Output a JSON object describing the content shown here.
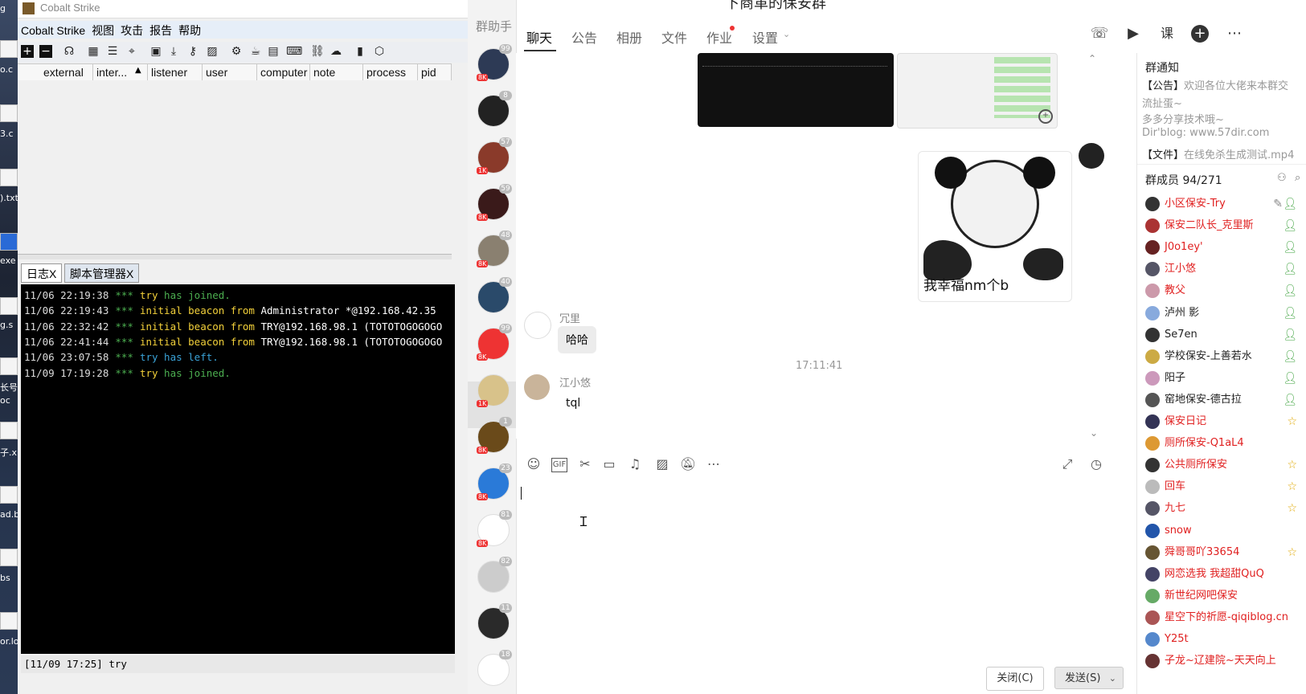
{
  "desktop": {
    "labels": [
      "g",
      "o.c",
      "3.c",
      ").txt",
      "exe",
      "g.s",
      "长号种",
      "oc",
      "子.xl",
      "ad.b",
      "bs",
      "or.lo"
    ]
  },
  "cs": {
    "title": "Cobalt Strike",
    "menu": [
      "Cobalt Strike",
      "视图",
      "攻击",
      "报告",
      "帮助"
    ],
    "columns": [
      "external",
      "inter...",
      "listener",
      "user",
      "computer",
      "note",
      "process",
      "pid"
    ],
    "tabs": [
      "日志X",
      "脚本管理器X"
    ],
    "log": [
      {
        "time": "11/06 22:19:38",
        "stars": "***",
        "pre": "",
        "who": "try",
        "rest": " has joined.",
        "kind": "join"
      },
      {
        "time": "11/06 22:19:43",
        "stars": "***",
        "pre": "initial beacon from ",
        "who": "Administrator *@192.168.42.35",
        "rest": "",
        "kind": "beacon"
      },
      {
        "time": "11/06 22:32:42",
        "stars": "***",
        "pre": "initial beacon from ",
        "who": "TRY@192.168.98.1 (TOTOTOGOGOGO",
        "rest": "",
        "kind": "beacon"
      },
      {
        "time": "11/06 22:41:44",
        "stars": "***",
        "pre": "initial beacon from ",
        "who": "TRY@192.168.98.1 (TOTOTOGOGOGO",
        "rest": "",
        "kind": "beacon"
      },
      {
        "time": "11/06 23:07:58",
        "stars": "***",
        "pre": "",
        "who": "try",
        "rest": " has left.",
        "kind": "left"
      },
      {
        "time": "11/09 17:19:28",
        "stars": "***",
        "pre": "",
        "who": "try",
        "rest": " has joined.",
        "kind": "join"
      }
    ],
    "status": "[11/09 17:25] try"
  },
  "qq": {
    "title": "下商革的保安群",
    "sidebar_header": "群助手",
    "group_badges": [
      "99",
      "8",
      "57",
      "59",
      "48",
      "40",
      "99",
      "",
      "1",
      "23",
      "81",
      "82",
      "11",
      "18"
    ],
    "group_levels": [
      "8K",
      "",
      "1K",
      "8K",
      "8K",
      "",
      "8K",
      "1K",
      "8K",
      "8K",
      "8K",
      "",
      "",
      ""
    ],
    "tabs": [
      "聊天",
      "公告",
      "相册",
      "文件",
      "作业",
      "设置"
    ],
    "chat": {
      "sticker_caption": "我幸福nm个b",
      "msg1_nick": "冗里",
      "msg1_text": "哈哈",
      "timestamp": "17:11:41",
      "msg2_nick": "江小悠",
      "msg2_text": "tql"
    },
    "buttons": {
      "close": "关闭(C)",
      "send": "发送(S)"
    },
    "notice": {
      "title": "群通知",
      "line1": "【公告】欢迎各位大佬来本群交",
      "line2": "流扯蛋~",
      "line3": "多多分享技术哦~",
      "line4": "Dir'blog: www.57dir.com",
      "file": "【文件】在线免杀生成测试.mp4"
    },
    "members_title": "群成员 94/271",
    "members": [
      {
        "name": "小区保安-Try",
        "color": "#e02020",
        "role": "admin"
      },
      {
        "name": "保安二队长_克里斯",
        "color": "#e02020",
        "role": "admin"
      },
      {
        "name": "J0o1ey'",
        "color": "#e02020",
        "role": "admin"
      },
      {
        "name": "江小悠",
        "color": "#e02020",
        "role": "admin"
      },
      {
        "name": "教父",
        "color": "#e02020",
        "role": "admin"
      },
      {
        "name": "泸州    影",
        "color": "#222222",
        "role": "admin"
      },
      {
        "name": "Se7en",
        "color": "#222222",
        "role": "admin"
      },
      {
        "name": "学校保安-上善若水",
        "color": "#222222",
        "role": "admin"
      },
      {
        "name": "阳子",
        "color": "#222222",
        "role": "admin"
      },
      {
        "name": "窑地保安-德古拉",
        "color": "#222222",
        "role": "admin"
      },
      {
        "name": "保安日记",
        "color": "#e02020",
        "role": "star"
      },
      {
        "name": "厕所保安-Q1aL4",
        "color": "#e02020",
        "role": "none"
      },
      {
        "name": "公共厕所保安",
        "color": "#e02020",
        "role": "star"
      },
      {
        "name": "回车",
        "color": "#e02020",
        "role": "star"
      },
      {
        "name": "九七",
        "color": "#e02020",
        "role": "star"
      },
      {
        "name": "snow",
        "color": "#e02020",
        "role": "none"
      },
      {
        "name": "舜哥哥吖33654",
        "color": "#e02020",
        "role": "star"
      },
      {
        "name": "网恋选我 我超甜QuQ",
        "color": "#e02020",
        "role": "none"
      },
      {
        "name": "新世纪网吧保安",
        "color": "#e02020",
        "role": "none"
      },
      {
        "name": "星空下的祈愿-qiqiblog.cn",
        "color": "#e02020",
        "role": "none"
      },
      {
        "name": "Y25t",
        "color": "#e02020",
        "role": "none"
      },
      {
        "name": "子龙~辽建院~天天向上",
        "color": "#e02020",
        "role": "none"
      }
    ]
  }
}
